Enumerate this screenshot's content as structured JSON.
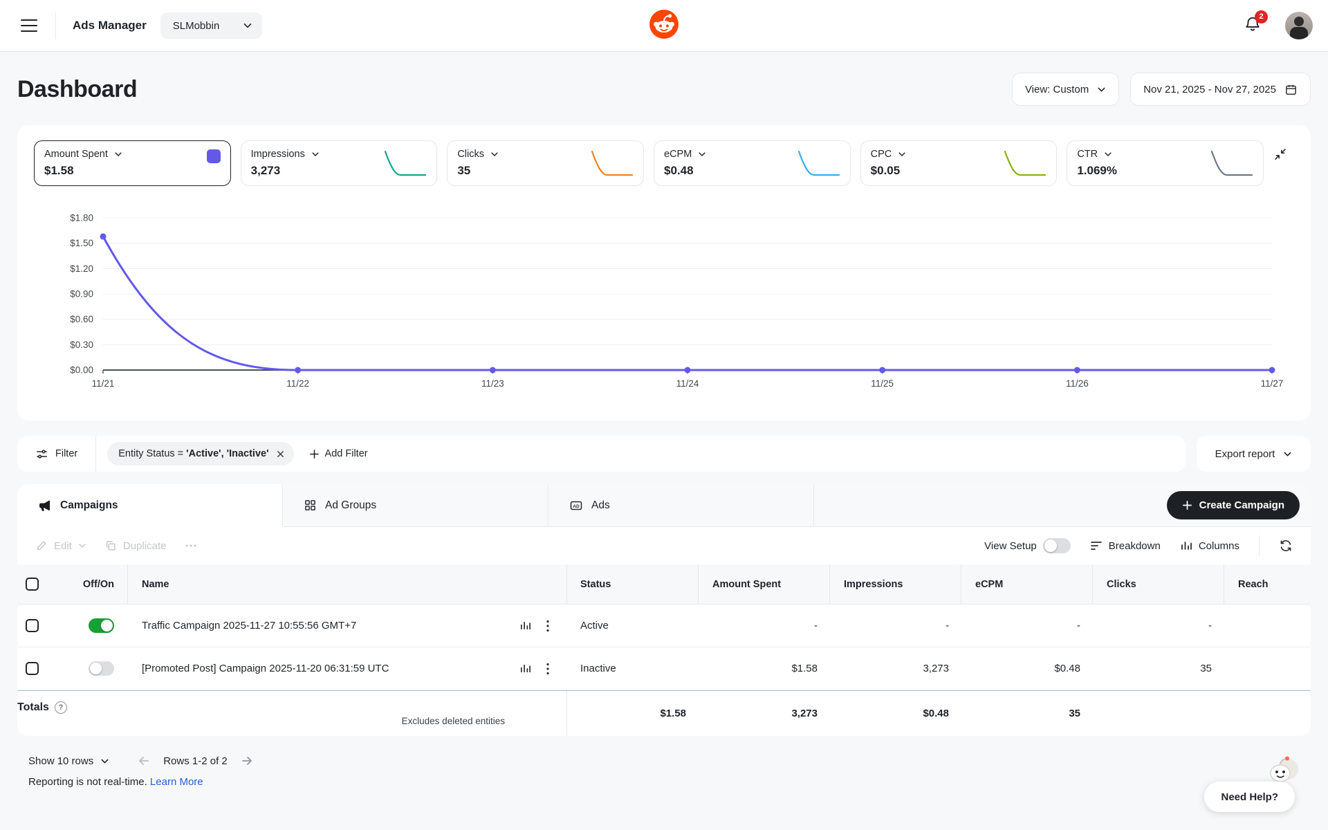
{
  "topbar": {
    "app_title": "Ads Manager",
    "account": "SLMobbin",
    "notification_count": "2"
  },
  "header": {
    "title": "Dashboard",
    "view_label": "View: Custom",
    "date_range": "Nov 21, 2025 - Nov 27, 2025"
  },
  "metric_cards": [
    {
      "label": "Amount Spent",
      "value": "$1.58",
      "selected": true,
      "color": "#6359e9"
    },
    {
      "label": "Impressions",
      "value": "3,273",
      "selected": false,
      "color": "#12a594"
    },
    {
      "label": "Clicks",
      "value": "35",
      "selected": false,
      "color": "#f28022"
    },
    {
      "label": "eCPM",
      "value": "$0.48",
      "selected": false,
      "color": "#35aee8"
    },
    {
      "label": "CPC",
      "value": "$0.05",
      "selected": false,
      "color": "#85b50e"
    },
    {
      "label": "CTR",
      "value": "1.069%",
      "selected": false,
      "color": "#6b7a85"
    }
  ],
  "chart_data": {
    "type": "line",
    "title": "Amount Spent",
    "x": [
      "11/21",
      "11/22",
      "11/23",
      "11/24",
      "11/25",
      "11/26",
      "11/27"
    ],
    "values": [
      1.58,
      0,
      0,
      0,
      0,
      0,
      0
    ],
    "ylim": [
      0,
      1.8
    ],
    "ytick_values": [
      1.8,
      1.5,
      1.2,
      0.9,
      0.6,
      0.3,
      0
    ],
    "ytick_labels": [
      "$1.80",
      "$1.50",
      "$1.20",
      "$0.90",
      "$0.60",
      "$0.30",
      "$0.00"
    ],
    "line_color": "#6359e9",
    "grid": true,
    "legend": "none"
  },
  "filter_bar": {
    "filter_label": "Filter",
    "chip_field": "Entity Status = ",
    "chip_value": "'Active', 'Inactive'",
    "add_filter": "Add Filter",
    "export": "Export report"
  },
  "tabs": [
    {
      "label": "Campaigns"
    },
    {
      "label": "Ad Groups"
    },
    {
      "label": "Ads",
      "icon_text": "AD"
    }
  ],
  "create_campaign": "Create Campaign",
  "toolbar": {
    "edit": "Edit",
    "duplicate": "Duplicate",
    "view_setup": "View Setup",
    "breakdown": "Breakdown",
    "columns": "Columns"
  },
  "table": {
    "headers": {
      "off_on": "Off/On",
      "name": "Name",
      "status": "Status",
      "amount": "Amount Spent",
      "impressions": "Impressions",
      "ecpm": "eCPM",
      "clicks": "Clicks",
      "reach": "Reach"
    },
    "rows": [
      {
        "name": "Traffic Campaign 2025-11-27 10:55:56 GMT+7",
        "toggle": "on",
        "status": "Active",
        "amount": "-",
        "impressions": "-",
        "ecpm": "-",
        "clicks": "-",
        "reach": ""
      },
      {
        "name": "[Promoted Post] Campaign 2025-11-20 06:31:59 UTC",
        "toggle": "off",
        "status": "Inactive",
        "amount": "$1.58",
        "impressions": "3,273",
        "ecpm": "$0.48",
        "clicks": "35",
        "reach": ""
      }
    ],
    "totals": {
      "label": "Totals",
      "note": "Excludes deleted entities",
      "amount": "$1.58",
      "impressions": "3,273",
      "ecpm": "$0.48",
      "clicks": "35",
      "reach": ""
    }
  },
  "footer": {
    "show_rows": "Show 10 rows",
    "pagination": "Rows 1-2 of 2",
    "note": "Reporting is not real-time.",
    "learn_more": "Learn More",
    "need_help": "Need Help?"
  },
  "colors": {
    "accent_purple": "#6359e9",
    "reddit_orange": "#ff4500",
    "toggle_green": "#18a035",
    "badge_red": "#e02424",
    "link_blue": "#2b5cd9"
  }
}
